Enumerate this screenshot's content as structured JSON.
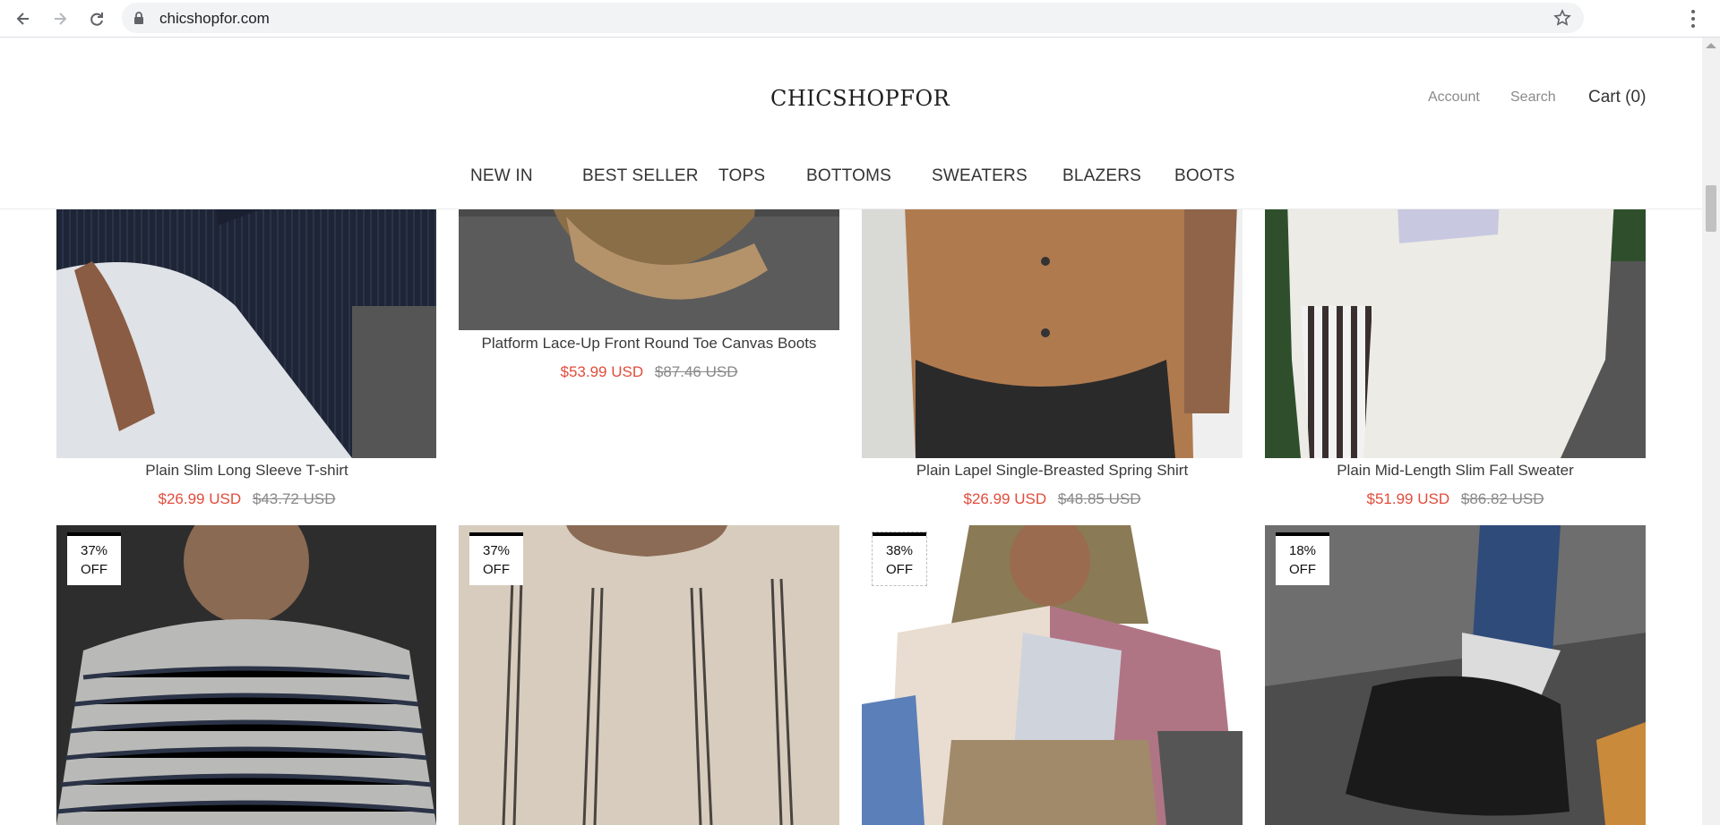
{
  "browser": {
    "url": "chicshopfor.com"
  },
  "header": {
    "logo": "CHICSHOPFOR",
    "account_label": "Account",
    "search_label": "Search",
    "cart_label": "Cart (0)"
  },
  "nav": {
    "items": [
      {
        "label": "NEW IN"
      },
      {
        "label": "BEST SELLER"
      },
      {
        "label": "TOPS"
      },
      {
        "label": "BOTTOMS"
      },
      {
        "label": "SWEATERS"
      },
      {
        "label": "BLAZERS"
      },
      {
        "label": "BOOTS"
      }
    ]
  },
  "products_row1": [
    {
      "title": "Plain Slim Long Sleeve T-shirt",
      "sale_price": "$26.99 USD",
      "compare_price": "$43.72 USD"
    },
    {
      "title": "Platform Lace-Up Front Round Toe Canvas Boots",
      "sale_price": "$53.99 USD",
      "compare_price": "$87.46 USD"
    },
    {
      "title": "Plain Lapel Single-Breasted Spring Shirt",
      "sale_price": "$26.99 USD",
      "compare_price": "$48.85 USD"
    },
    {
      "title": "Plain Mid-Length Slim Fall Sweater",
      "sale_price": "$51.99 USD",
      "compare_price": "$86.82 USD"
    }
  ],
  "products_row2": [
    {
      "badge_pct": "37%",
      "badge_off": "OFF"
    },
    {
      "badge_pct": "37%",
      "badge_off": "OFF"
    },
    {
      "badge_pct": "38%",
      "badge_off": "OFF"
    },
    {
      "badge_pct": "18%",
      "badge_off": "OFF"
    }
  ],
  "colors": {
    "sale": "#e14c3b",
    "text": "#333333",
    "muted": "#888888"
  }
}
